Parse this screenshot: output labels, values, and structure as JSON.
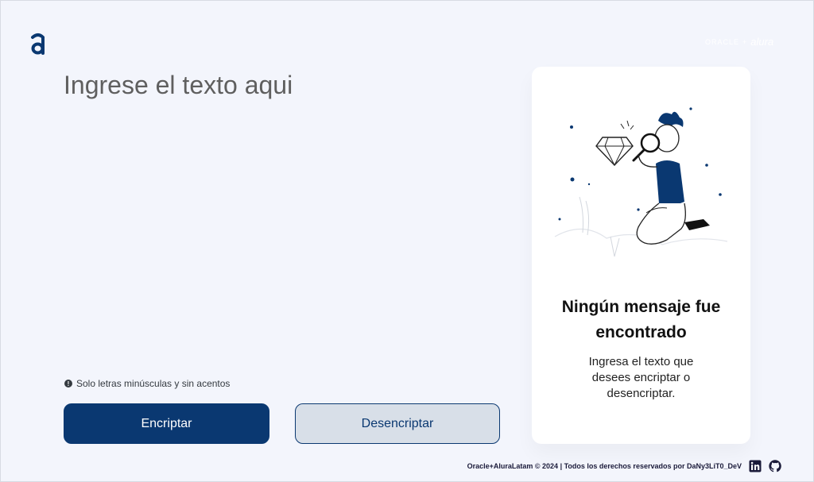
{
  "header": {
    "logo_icon": "alura-logo",
    "partner_logo": {
      "oracle": "ORACLE",
      "separator": "+",
      "alura": "alura"
    }
  },
  "editor": {
    "placeholder": "Ingrese el texto aqui",
    "value": ""
  },
  "hint": {
    "icon": "info-icon",
    "text": "Solo letras minúsculas y sin acentos"
  },
  "buttons": {
    "encrypt": "Encriptar",
    "decrypt": "Desencriptar"
  },
  "result": {
    "illustration": "boy-with-magnifying-glass",
    "title": "Ningún mensaje fue encontrado",
    "description": "Ingresa el texto que desees encriptar o desencriptar."
  },
  "footer": {
    "text": "Oracle+AluraLatam © 2024 | Todos los derechos reservados por DaNy3LiT0_DeV",
    "social": [
      "linkedin-icon",
      "github-icon"
    ]
  },
  "colors": {
    "background": "#f3f5fc",
    "primary": "#0a3871",
    "secondary": "#d8dfe8",
    "card": "#ffffff"
  }
}
